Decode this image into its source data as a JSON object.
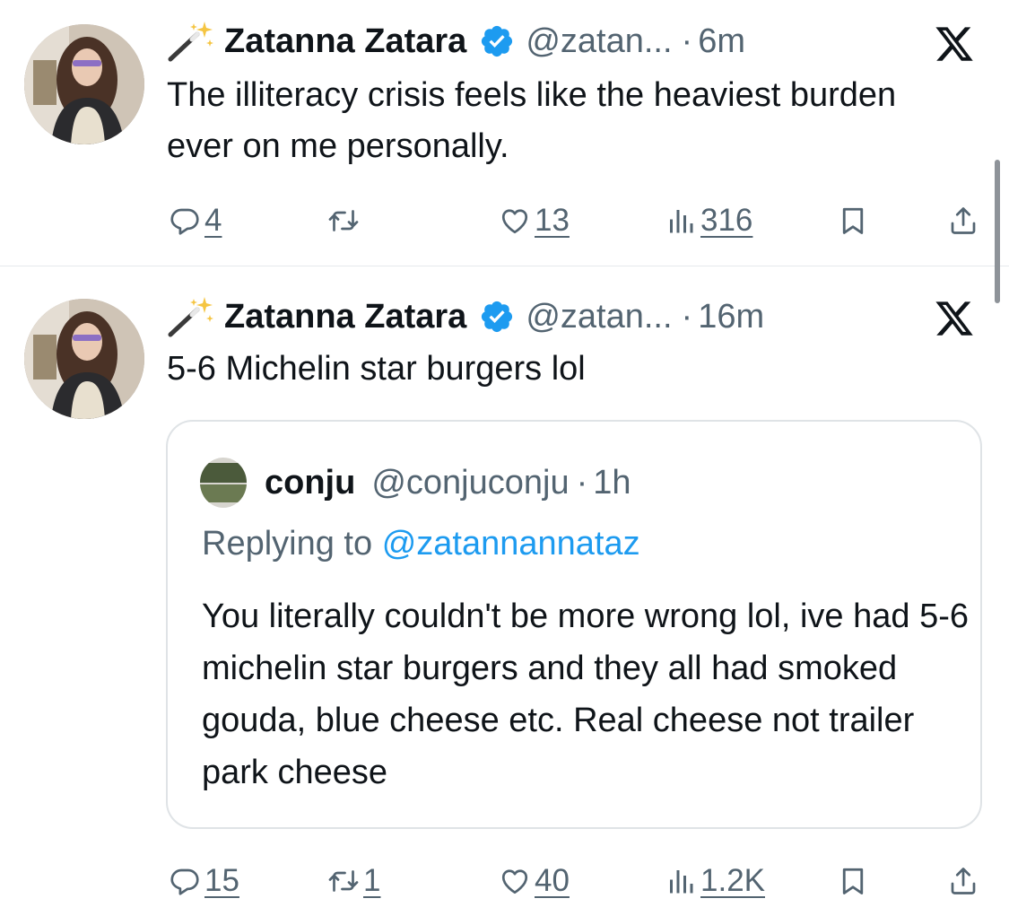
{
  "colors": {
    "text": "#0f1419",
    "secondary": "#536471",
    "accent": "#1d9bf0",
    "border": "#dfe3e6"
  },
  "tweets": [
    {
      "display_name": "Zatanna Zatara",
      "handle": "@zatan...",
      "separator": "·",
      "time": "6m",
      "text": "The illiteracy crisis feels like the heaviest burden ever on me personally.",
      "stats": {
        "replies": "4",
        "retweets": "",
        "likes": "13",
        "views": "316"
      }
    },
    {
      "display_name": "Zatanna Zatara",
      "handle": "@zatan...",
      "separator": "·",
      "time": "16m",
      "text": "5-6 Michelin star burgers lol",
      "quote": {
        "display_name": "conju",
        "handle": "@conjuconju",
        "separator": "·",
        "time": "1h",
        "replying_prefix": "Replying to",
        "replying_to": "@zatannannataz",
        "text": "You literally couldn't be more wrong lol, ive had 5-6 michelin star burgers and they all had smoked gouda, blue cheese etc. Real cheese not trailer park cheese"
      },
      "stats": {
        "replies": "15",
        "retweets": "1",
        "likes": "40",
        "views": "1.2K"
      }
    }
  ],
  "icons": [
    "magic-wand-icon",
    "verified-badge-icon",
    "x-logo-icon",
    "reply-icon",
    "retweet-icon",
    "like-icon",
    "views-icon",
    "bookmark-icon",
    "share-icon"
  ]
}
